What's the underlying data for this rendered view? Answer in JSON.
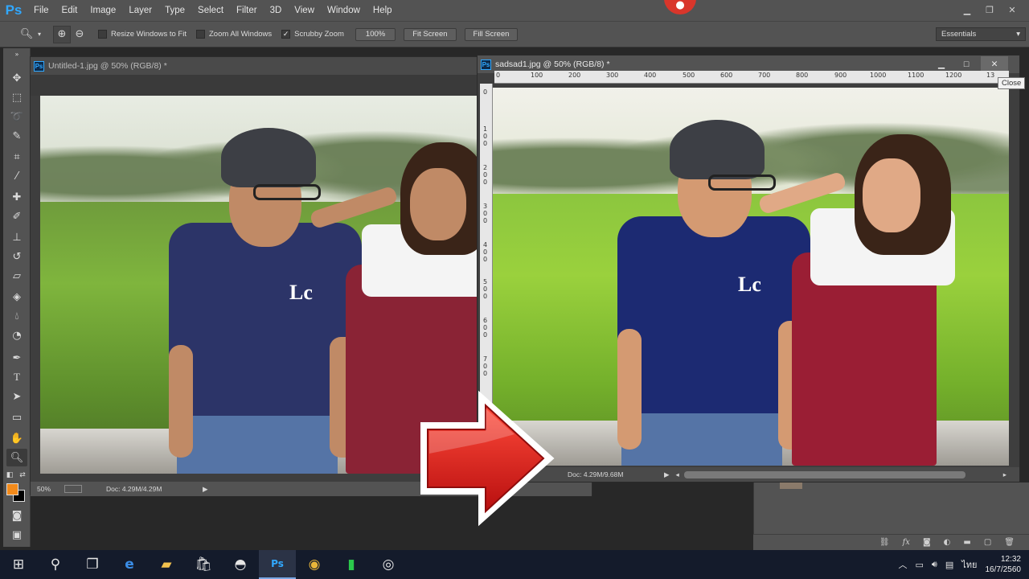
{
  "app": {
    "logo": "Ps",
    "menu": [
      "File",
      "Edit",
      "Image",
      "Layer",
      "Type",
      "Select",
      "Filter",
      "3D",
      "View",
      "Window",
      "Help"
    ],
    "window_controls": [
      "minimize",
      "restore",
      "close"
    ]
  },
  "options_bar": {
    "resize_windows_label": "Resize Windows to Fit",
    "zoom_all_windows_label": "Zoom All Windows",
    "scrubby_zoom_label": "Scrubby Zoom",
    "zoom_value": "100%",
    "fit_screen_label": "Fit Screen",
    "fill_screen_label": "Fill Screen",
    "workspace": "Essentials"
  },
  "toolbar": {
    "tools": [
      "move-tool",
      "marquee-tool",
      "lasso-tool",
      "quick-select-tool",
      "crop-tool",
      "eyedropper-tool",
      "healing-brush-tool",
      "brush-tool",
      "clone-stamp-tool",
      "history-brush-tool",
      "eraser-tool",
      "paint-bucket-tool",
      "blur-tool",
      "dodge-tool",
      "pen-tool",
      "type-tool",
      "path-select-tool",
      "shape-tool",
      "hand-tool",
      "zoom-tool"
    ],
    "foreground_color": "#f28a1b",
    "background_color": "#000000"
  },
  "doc1": {
    "title": "Untitled-1.jpg @ 50% (RGB/8) *",
    "zoom": "50%",
    "doc_size": "Doc: 4.29M/4.29M"
  },
  "doc2": {
    "title": "sadsad1.jpg @ 50% (RGB/8) *",
    "doc_size": "Doc: 4.29M/9.68M",
    "close_tooltip": "Close",
    "ruler_h": [
      "0",
      "100",
      "200",
      "300",
      "400",
      "500",
      "600",
      "700",
      "800",
      "900",
      "1000",
      "1100",
      "1200",
      "13"
    ],
    "ruler_v": [
      "0",
      "1\n0\n0",
      "2\n0\n0",
      "3\n0\n0",
      "4\n0\n0",
      "5\n0\n0",
      "6\n0\n0",
      "7\n0\n0"
    ]
  },
  "shirt_print": "Lc",
  "taskbar": {
    "items": [
      "start-icon",
      "search-icon",
      "task-view-icon",
      "edge-icon",
      "file-explorer-icon",
      "store-icon",
      "app-icon",
      "photoshop-icon",
      "chrome-icon",
      "line-icon",
      "obs-icon"
    ],
    "active": "photoshop-icon",
    "tray_lang": "ไทย",
    "time": "12:32",
    "date": "16/7/2560"
  }
}
